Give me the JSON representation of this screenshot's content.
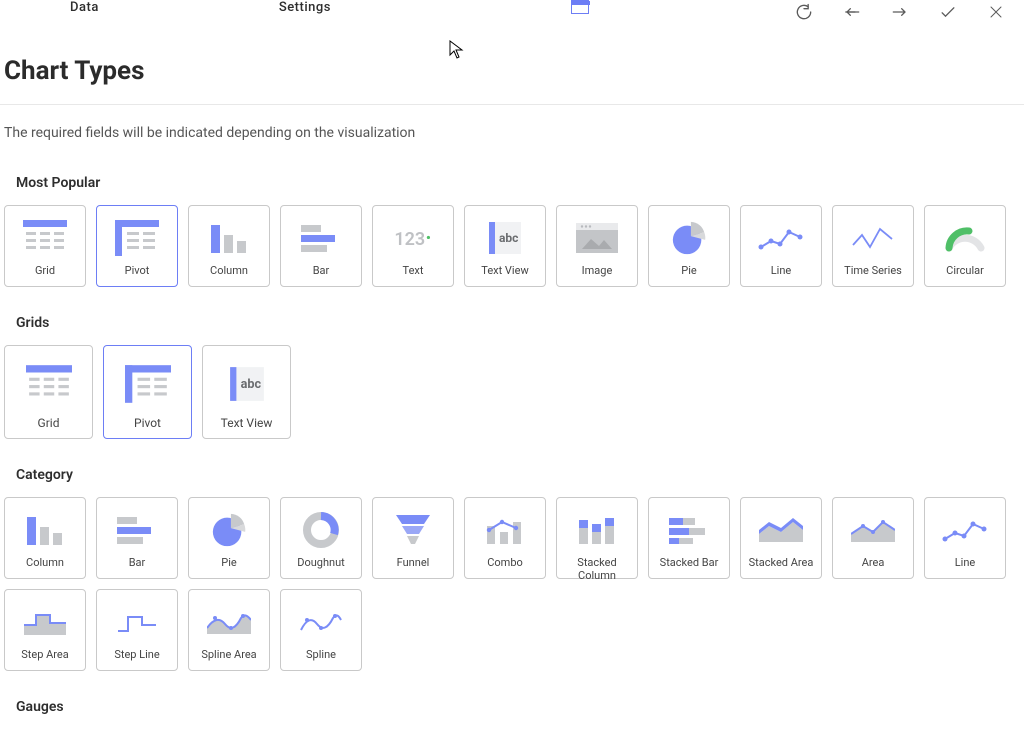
{
  "topbar": {
    "tab1": "Data",
    "tab2": "Settings"
  },
  "page_title": "Chart Types",
  "subtitle": "The required fields will be indicated depending on the visualization",
  "sections": {
    "popular": {
      "label": "Most Popular",
      "items": [
        "Grid",
        "Pivot",
        "Column",
        "Bar",
        "Text",
        "Text View",
        "Image",
        "Pie",
        "Line",
        "Time Series",
        "Circular"
      ]
    },
    "grids": {
      "label": "Grids",
      "items": [
        "Grid",
        "Pivot",
        "Text View"
      ]
    },
    "category": {
      "label": "Category",
      "items": [
        "Column",
        "Bar",
        "Pie",
        "Doughnut",
        "Funnel",
        "Combo",
        "Stacked Column",
        "Stacked Bar",
        "Stacked Area",
        "Area",
        "Line",
        "Step Area",
        "Step Line",
        "Spline Area",
        "Spline"
      ]
    },
    "gauges": {
      "label": "Gauges"
    }
  }
}
